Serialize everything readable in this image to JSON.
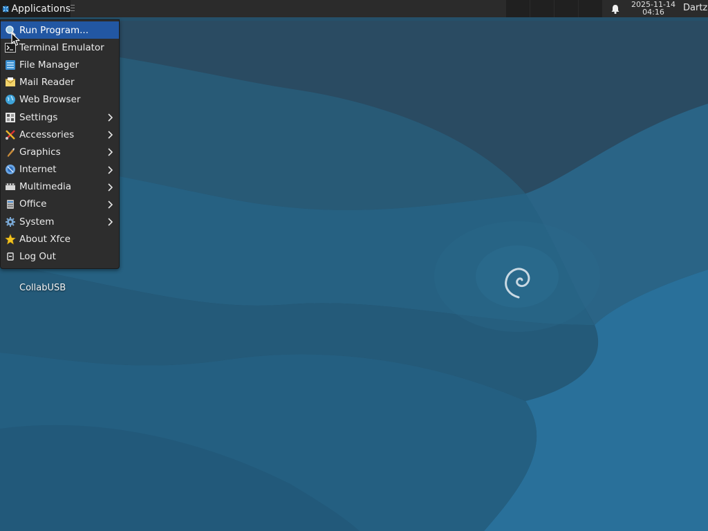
{
  "panel": {
    "applications_label": "Applications",
    "clock_date": "2025-11-14",
    "clock_time": "04:16",
    "user": "Dartz",
    "workspaces_count": 4
  },
  "menu": {
    "items": [
      {
        "label": "Run Program...",
        "icon": "run-program-icon",
        "submenu": false,
        "active": true
      },
      {
        "label": "Terminal Emulator",
        "icon": "terminal-icon",
        "submenu": false
      },
      {
        "label": "File Manager",
        "icon": "file-manager-icon",
        "submenu": false
      },
      {
        "label": "Mail Reader",
        "icon": "mail-icon",
        "submenu": false
      },
      {
        "label": "Web Browser",
        "icon": "web-browser-icon",
        "submenu": false
      },
      {
        "label": "Settings",
        "icon": "settings-icon",
        "submenu": true
      },
      {
        "label": "Accessories",
        "icon": "accessories-icon",
        "submenu": true
      },
      {
        "label": "Graphics",
        "icon": "graphics-icon",
        "submenu": true
      },
      {
        "label": "Internet",
        "icon": "internet-icon",
        "submenu": true
      },
      {
        "label": "Multimedia",
        "icon": "multimedia-icon",
        "submenu": true
      },
      {
        "label": "Office",
        "icon": "office-icon",
        "submenu": true
      },
      {
        "label": "System",
        "icon": "system-icon",
        "submenu": true
      },
      {
        "label": "About Xfce",
        "icon": "star-icon",
        "submenu": false
      },
      {
        "label": "Log Out",
        "icon": "logout-icon",
        "submenu": false
      }
    ]
  },
  "desktop": {
    "icon_label": "CollabUSB"
  },
  "colors": {
    "panel_bg": "#2b2b2b",
    "menu_bg": "#2d2d2d",
    "menu_highlight": "#2257a3",
    "wallpaper": "#24556f"
  }
}
